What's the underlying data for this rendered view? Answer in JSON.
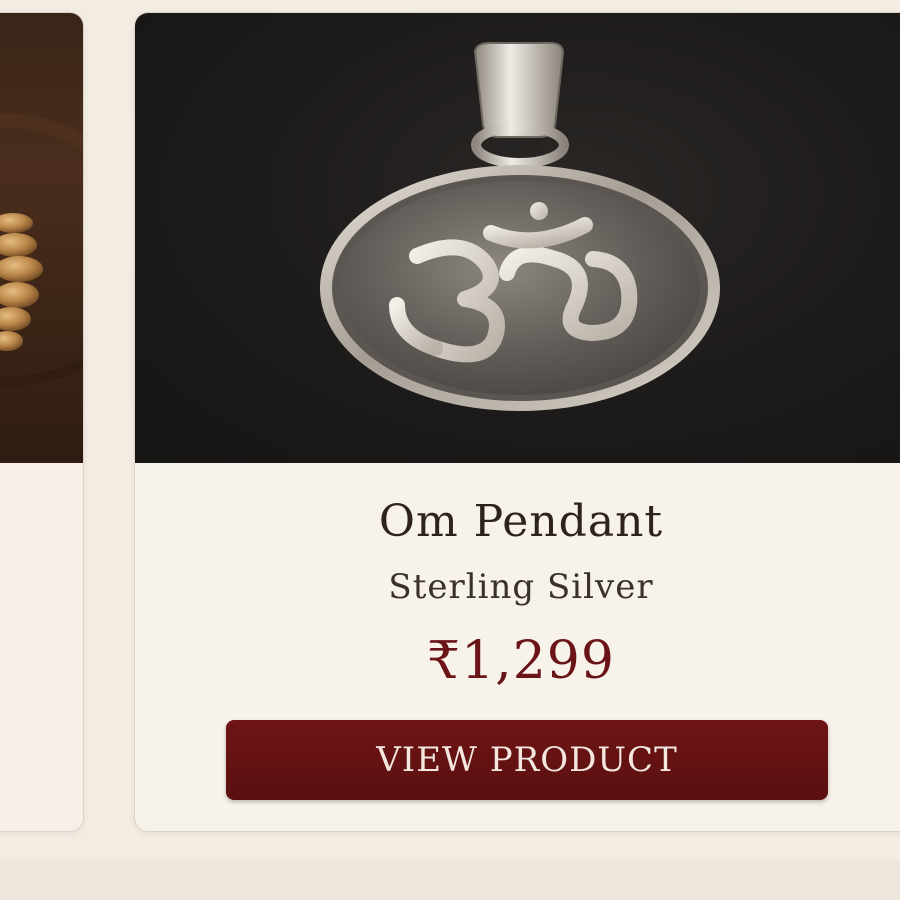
{
  "product": {
    "name": "Om Pendant",
    "material": "Sterling Silver",
    "price": "₹1,299",
    "button_label": "VIEW PRODUCT"
  },
  "colors": {
    "page_background": "#f3ece3",
    "card_background": "#f7f2ea",
    "price": "#6a1418",
    "button_background": "#6f1515",
    "button_text": "#f3e7df"
  },
  "icons": {
    "main_image": "om-pendant-image",
    "left_image": "rudraksha-beads-image"
  }
}
